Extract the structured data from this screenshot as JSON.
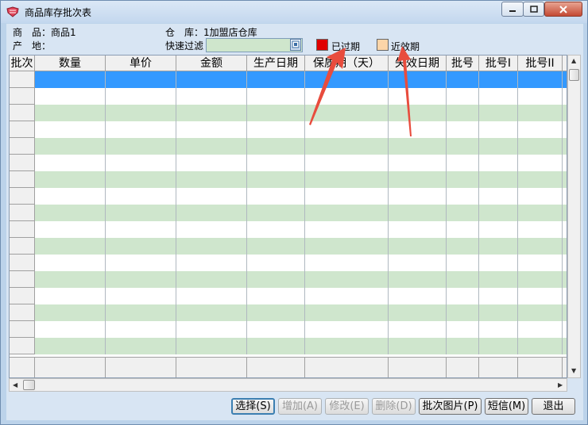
{
  "window": {
    "title": "商品库存批次表"
  },
  "info": {
    "product_label": "商　品：",
    "product_value": "商品1",
    "origin_label": "产　地：",
    "warehouse_label": "仓　库：",
    "warehouse_value": "1加盟店仓库",
    "filter_label": "快速过滤"
  },
  "legend": [
    {
      "label": "已过期",
      "color": "#e00000"
    },
    {
      "label": "近效期",
      "color": "#fcd5a8"
    }
  ],
  "table": {
    "columns": [
      "批次",
      "数量",
      "单价",
      "金额",
      "生产日期",
      "保质期（天）",
      "失效日期",
      "批号",
      "批号I",
      "批号II"
    ],
    "row_colors": {
      "selected": "#3399ff",
      "odd": "#ffffff",
      "even": "#cfe6cd"
    },
    "row_count": 17
  },
  "buttons": [
    {
      "label": "选择(S)",
      "enabled": true
    },
    {
      "label": "增加(A)",
      "enabled": false
    },
    {
      "label": "修改(E)",
      "enabled": false
    },
    {
      "label": "删除(D)",
      "enabled": false
    },
    {
      "label": "批次图片(P)",
      "enabled": true
    },
    {
      "label": "短信(M)",
      "enabled": true
    },
    {
      "label": "退出",
      "enabled": true
    }
  ],
  "annotations": {
    "arrow_color": "#e84c3d"
  }
}
